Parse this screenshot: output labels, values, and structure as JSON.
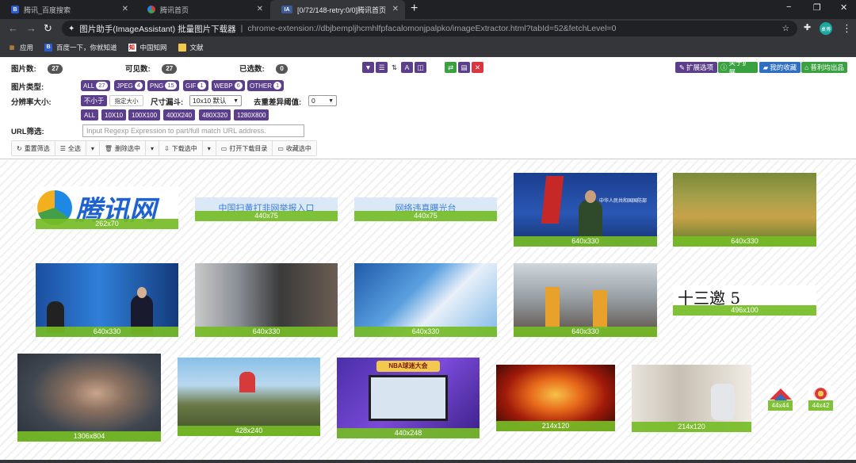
{
  "browser": {
    "tabs": [
      {
        "title": "腾讯_百度搜索",
        "fav": "B"
      },
      {
        "title": "腾讯首页",
        "fav": "Q"
      },
      {
        "title": "[0/72/148-retry:0/0]腾讯首页",
        "fav": "IA"
      }
    ],
    "new_tab": "+",
    "window_controls": [
      "−",
      "❐",
      "✕"
    ],
    "address": {
      "page_title": "图片助手(ImageAssistant) 批量图片下载器",
      "separator": "|",
      "url": "chrome-extension://dbjbempljhcmhlfpfacalomonjpalpko/imageExtractor.html?tabId=52&fetchLevel=0"
    },
    "profile_label": "桌博",
    "bookmarks": [
      {
        "label": "应用",
        "icon": "apps-icon"
      },
      {
        "label": "百度一下，你就知道",
        "icon": "baidu-icon"
      },
      {
        "label": "中国知网",
        "icon": "cnki-icon"
      },
      {
        "label": "文献",
        "icon": "folder-icon"
      }
    ]
  },
  "stats": {
    "image_count_label": "图片数:",
    "image_count": "27",
    "visible_count_label": "可见数:",
    "visible_count": "27",
    "selected_count_label": "已选数:",
    "selected_count": "0"
  },
  "toolbar": {
    "ext_options": "扩展选项",
    "about": "关于扩展",
    "favorites": "我的收藏",
    "benefits": "普利均出品"
  },
  "filters": {
    "type_label": "图片类型:",
    "types": [
      {
        "name": "ALL",
        "count": "27"
      },
      {
        "name": "JPEG",
        "count": "4"
      },
      {
        "name": "PNG",
        "count": "15"
      },
      {
        "name": "GIF",
        "count": "1"
      },
      {
        "name": "WEBP",
        "count": "6"
      },
      {
        "name": "OTHER",
        "count": "1"
      }
    ],
    "resolution_label": "分辨率大小:",
    "not_less": "不小于",
    "specified": "指定大小",
    "size_funnel_label": "尺寸漏斗:",
    "size_funnel_value": "10x10 默认",
    "dedupe_label": "去重差异阈值:",
    "dedupe_value": "0",
    "sizes": [
      "ALL",
      "10X10",
      "100X100",
      "400X240",
      "480X320",
      "1280X800"
    ],
    "url_label": "URL筛选:",
    "url_placeholder": "Input Regexp Expression to part/full match URL address."
  },
  "actions": [
    {
      "label": "重置筛选",
      "icon": "refresh-icon"
    },
    {
      "label": "全选",
      "icon": "list-icon"
    },
    {
      "label": "",
      "icon": "caret-icon"
    },
    {
      "label": "删除选中",
      "icon": "trash-icon"
    },
    {
      "label": "",
      "icon": "caret-icon"
    },
    {
      "label": "下载选中",
      "icon": "download-icon"
    },
    {
      "label": "",
      "icon": "caret-icon"
    },
    {
      "label": "打开下载目录",
      "icon": "folder-open-icon"
    },
    {
      "label": "收藏选中",
      "icon": "folder-star-icon"
    }
  ],
  "images": [
    {
      "size": "262x70",
      "text": "腾讯网"
    },
    {
      "size": "440x75",
      "text": "中国扫黄打非网举报入口"
    },
    {
      "size": "440x75",
      "text": "网络违真曝光台"
    },
    {
      "size": "640x330",
      "text": "中华人民共和国国防部"
    },
    {
      "size": "640x330",
      "text": ""
    },
    {
      "size": "640x330",
      "text": ""
    },
    {
      "size": "640x330",
      "text": ""
    },
    {
      "size": "640x330",
      "text": ""
    },
    {
      "size": "640x330",
      "text": ""
    },
    {
      "size": "496x100",
      "text": "十三邀 5"
    },
    {
      "size": "1306x804",
      "text": ""
    },
    {
      "size": "428x240",
      "text": ""
    },
    {
      "size": "440x248",
      "text": "NBA球迷大会"
    },
    {
      "size": "214x120",
      "text": ""
    },
    {
      "size": "214x120",
      "text": ""
    },
    {
      "size": "44x44",
      "text": ""
    },
    {
      "size": "44x42",
      "text": ""
    }
  ],
  "colors": {
    "purple": "#5b3f8a",
    "green": "#3aa140",
    "red": "#d9363e",
    "caption": "#76bc26"
  }
}
